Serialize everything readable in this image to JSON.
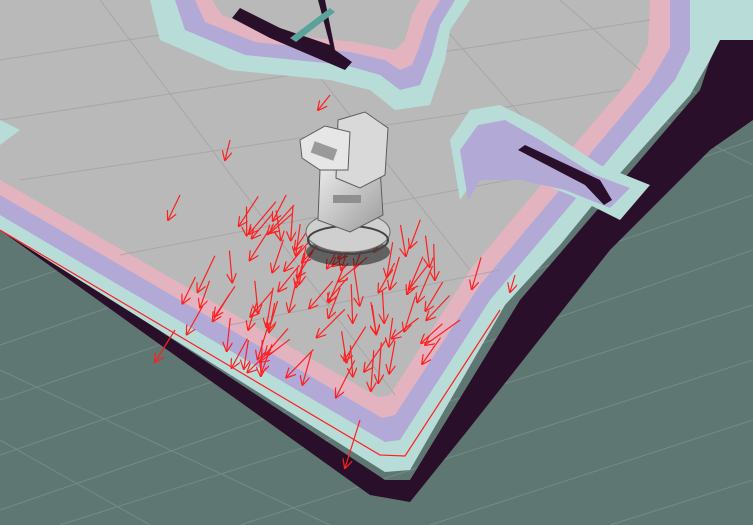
{
  "colors": {
    "background_floor": "#5f7773",
    "grid_line": "#7f8f8c",
    "free_space": "#b9b9b9",
    "free_space_grid": "#a9a9a9",
    "inflation_cyan": "#b8ddd9",
    "inflation_lavender": "#b2a9d7",
    "inflation_pink": "#e4b3c0",
    "obstacle_dark": "#2a0f2a",
    "particle_arrow": "#ff1f1f",
    "robot_body": "#cfcfcf",
    "robot_shadow": "#8d8d8d"
  },
  "scene": {
    "robot_icon": "mobile-robot-model",
    "particle_icon": "arrow-pose-icon",
    "particle_count": 90
  }
}
